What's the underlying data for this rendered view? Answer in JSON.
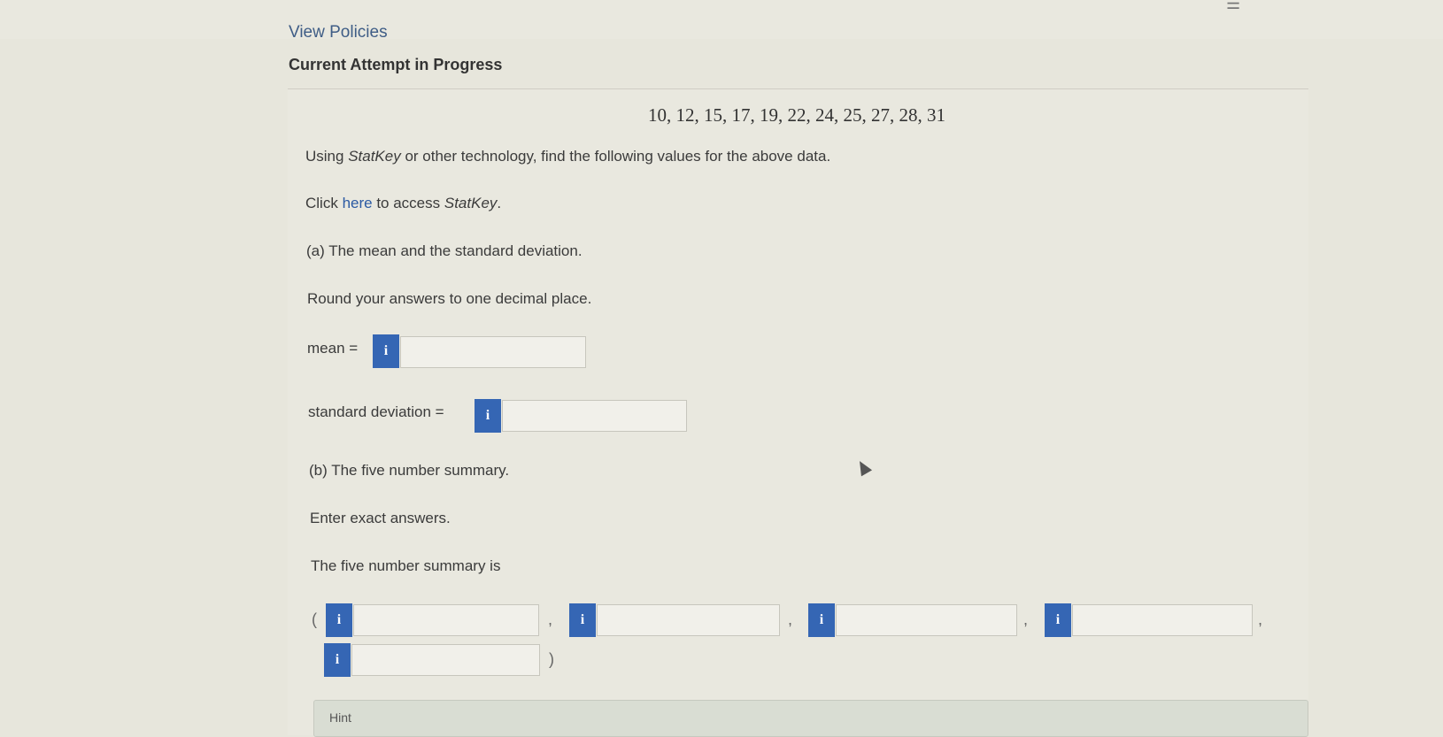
{
  "header": {
    "view_policies": "View Policies",
    "attempt_status": "Current Attempt in Progress"
  },
  "question": {
    "data_values": "10, 12, 15, 17, 19, 22, 24, 25, 27, 28, 31",
    "instruction_prefix": "Using ",
    "statkey": "StatKey",
    "instruction_suffix": " or other technology, find the following values for the above data.",
    "click_prefix": "Click ",
    "click_link": "here",
    "click_suffix": " to access ",
    "click_end": ".",
    "part_a": "(a) The mean and the standard deviation.",
    "round_note": "Round your answers to one decimal place.",
    "mean_label": "mean =",
    "sd_label": "standard deviation =",
    "part_b": "(b) The five number summary.",
    "exact_note": "Enter exact answers.",
    "five_num_label": "The five number summary is",
    "open_paren": "(",
    "close_paren": ")",
    "comma": ","
  },
  "inputs": {
    "mean_value": "",
    "sd_value": "",
    "five_num_values": [
      "",
      "",
      "",
      "",
      ""
    ]
  },
  "info_icon_glyph": "i",
  "icons": [
    "info-icon",
    "cursor-icon",
    "list-icon"
  ],
  "hint": {
    "label": "Hint"
  }
}
